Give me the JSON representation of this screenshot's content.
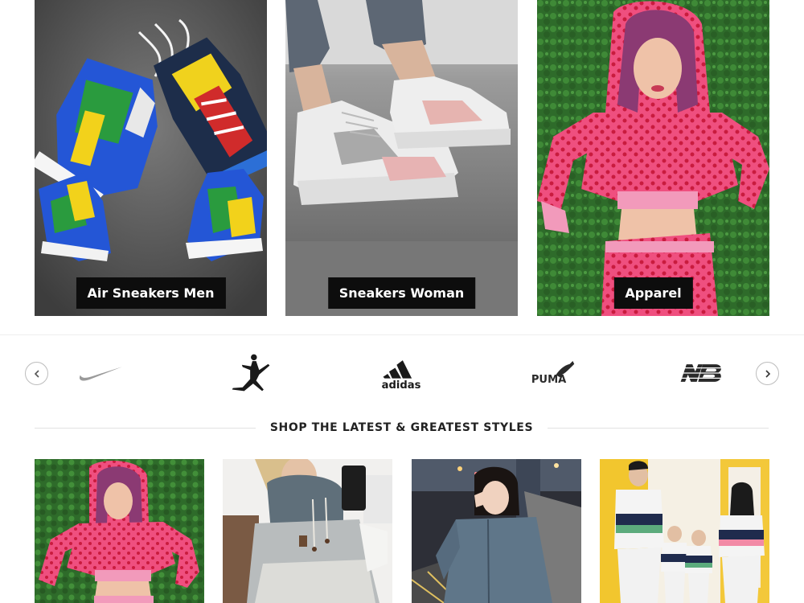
{
  "categories": [
    {
      "label": "Air Sneakers Men",
      "image": "colorful-sneakers-photo"
    },
    {
      "label": "Sneakers Woman",
      "image": "white-sneakers-on-feet-photo"
    },
    {
      "label": "Apparel",
      "image": "pink-heart-tracksuit-photo"
    }
  ],
  "brands": [
    {
      "name": "Nike",
      "logo": "nike-swoosh-logo",
      "color": "#9a9a9a"
    },
    {
      "name": "Jordan",
      "logo": "jumpman-logo",
      "color": "#1a1a1a"
    },
    {
      "name": "adidas",
      "logo": "adidas-logo",
      "color": "#1a1a1a"
    },
    {
      "name": "PUMA",
      "logo": "puma-logo",
      "color": "#2a2a2a"
    },
    {
      "name": "New Balance",
      "logo": "new-balance-logo",
      "color": "#2a2a2a"
    }
  ],
  "carousel": {
    "prev_icon": "chevron-left-icon",
    "next_icon": "chevron-right-icon"
  },
  "section": {
    "title": "SHOP THE LATEST & GREATEST STYLES"
  },
  "products": [
    {
      "image": "pink-heart-tracksuit-woman"
    },
    {
      "image": "grey-hoodie-selfie"
    },
    {
      "image": "blue-hoodie-street-night"
    },
    {
      "image": "family-matching-sweaters"
    }
  ],
  "colors": {
    "label_bg": "#0d0d0d",
    "label_text": "#ffffff",
    "heading_text": "#222222"
  }
}
